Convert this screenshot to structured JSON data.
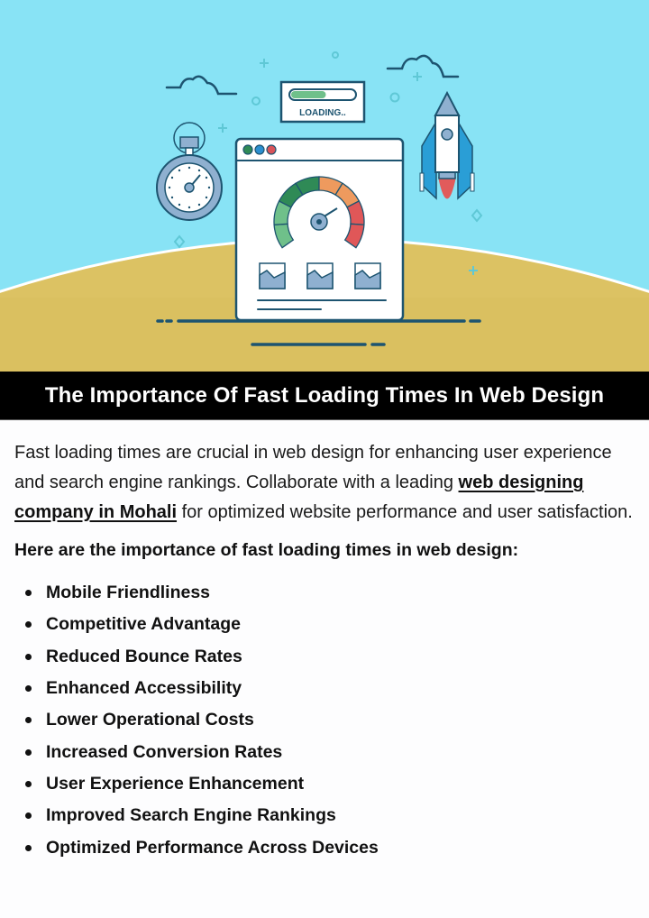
{
  "illustration": {
    "loading_label": "LOADING..",
    "loading_progress": 0.55,
    "colors": {
      "sky": "#88e3f5",
      "ground": "#dcc263",
      "outline": "#1d5470",
      "gauge_green_light": "#6fc08a",
      "gauge_green_dark": "#2f8a56",
      "gauge_orange": "#ee9a5e",
      "gauge_red": "#e05758",
      "window_dot_1": "#2f8a56",
      "window_dot_2": "#2a8fd0",
      "window_dot_3": "#d9545a",
      "rocket_fin": "#2a9ed6",
      "rocket_flame": "#e15b5b"
    }
  },
  "banner": {
    "title": "The Importance Of Fast Loading Times In Web Design"
  },
  "intro": {
    "text_before_link": "Fast loading times are crucial in web design for enhancing user experience and search engine rankings. Collaborate with a leading ",
    "link_text": "web designing company in Mohali",
    "text_after_link": " for optimized website performance and user satisfaction."
  },
  "lead": "Here are the importance of fast loading times in web design:",
  "points": [
    "Mobile Friendliness",
    "Competitive Advantage",
    "Reduced Bounce Rates",
    "Enhanced Accessibility",
    "Lower Operational Costs",
    "Increased Conversion Rates",
    "User Experience Enhancement",
    "Improved Search Engine Rankings",
    "Optimized Performance Across Devices"
  ]
}
